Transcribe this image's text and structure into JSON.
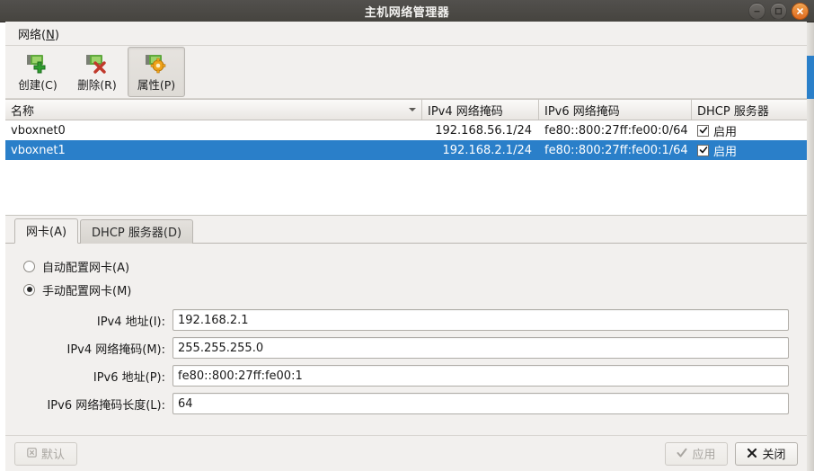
{
  "window": {
    "title": "主机网络管理器",
    "controls": [
      {
        "name": "minimize",
        "glyph": "minimize-icon"
      },
      {
        "name": "maximize",
        "glyph": "maximize-icon"
      },
      {
        "name": "close",
        "glyph": "close-icon"
      }
    ]
  },
  "menubar": {
    "items": [
      {
        "label_before": "网络(",
        "accel": "N",
        "label_after": ")"
      }
    ]
  },
  "toolbar": {
    "buttons": [
      {
        "label": "创建(C)",
        "icon": "network-add-icon",
        "pressed": false
      },
      {
        "label": "删除(R)",
        "icon": "network-remove-icon",
        "pressed": false
      },
      {
        "label": "属性(P)",
        "icon": "network-properties-icon",
        "pressed": true
      }
    ]
  },
  "table": {
    "columns": [
      {
        "label": "名称",
        "sorted": true
      },
      {
        "label": "IPv4 网络掩码",
        "sorted": false
      },
      {
        "label": "IPv6 网络掩码",
        "sorted": false
      },
      {
        "label": "DHCP 服务器",
        "sorted": false
      }
    ],
    "rows": [
      {
        "name": "vboxnet0",
        "ipv4_mask": "192.168.56.1/24",
        "ipv6_mask": "fe80::800:27ff:fe00:0/64",
        "dhcp_checked": true,
        "dhcp_label": "启用",
        "selected": false
      },
      {
        "name": "vboxnet1",
        "ipv4_mask": "192.168.2.1/24",
        "ipv6_mask": "fe80::800:27ff:fe00:1/64",
        "dhcp_checked": true,
        "dhcp_label": "启用",
        "selected": true
      }
    ]
  },
  "tabs": [
    {
      "label": "网卡(A)",
      "active": true
    },
    {
      "label": "DHCP 服务器(D)",
      "active": false
    }
  ],
  "adapter_panel": {
    "radios": [
      {
        "label": "自动配置网卡(A)",
        "selected": false
      },
      {
        "label": "手动配置网卡(M)",
        "selected": true
      }
    ],
    "fields": [
      {
        "label": "IPv4 地址(I):",
        "value": "192.168.2.1"
      },
      {
        "label": "IPv4 网络掩码(M):",
        "value": "255.255.255.0"
      },
      {
        "label": "IPv6 地址(P):",
        "value": "fe80::800:27ff:fe00:1"
      },
      {
        "label": "IPv6 网络掩码长度(L):",
        "value": "64"
      }
    ]
  },
  "footer": {
    "default_label": "默认",
    "apply_label": "应用",
    "close_label": "关闭"
  },
  "colors": {
    "selection_blue": "#2a7fc9",
    "titlebar": "#4a4844",
    "close_orange": "#e06b22",
    "window_bg": "#f2f0ee"
  }
}
